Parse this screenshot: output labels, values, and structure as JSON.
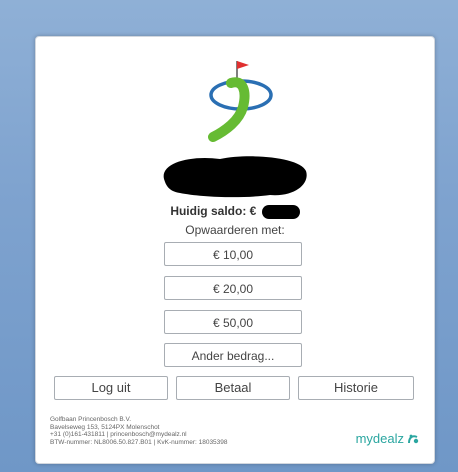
{
  "balance": {
    "label": "Huidig saldo: €"
  },
  "topup": {
    "label": "Opwaarderen met:",
    "amounts": [
      "€ 10,00",
      "€ 20,00",
      "€ 50,00"
    ],
    "other_label": "Ander bedrag..."
  },
  "actions": {
    "logout_label": "Log uit",
    "pay_label": "Betaal",
    "history_label": "Historie"
  },
  "footer": {
    "lines": [
      "Golfbaan Princenbosch B.V.",
      "Bavelseweg 153, 5124PX Molenschot",
      "+31 (0)161-431811 | princenbosch@mydealz.nl",
      "BTW-nummer: NL8006.50.827.B01 | KvK-nummer: 18035398"
    ]
  },
  "brand": {
    "name": "mydealz",
    "icon": "mydealz-logo-icon",
    "color": "#2aa6a0"
  },
  "colors": {
    "accent_green": "#66bb33",
    "accent_blue": "#2a6fb3",
    "flag_red": "#e03030"
  }
}
